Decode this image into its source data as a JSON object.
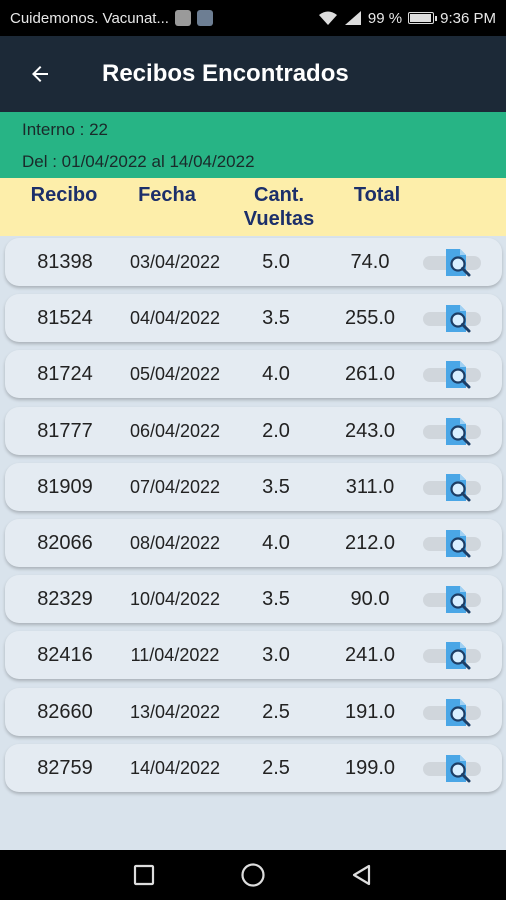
{
  "status_bar": {
    "notification_text": "Cuidemonos. Vacunat...",
    "battery_percent": "99 %",
    "time": "9:36 PM"
  },
  "app_bar": {
    "title": "Recibos Encontrados"
  },
  "info": {
    "interno": "Interno : 22",
    "rango": "Del : 01/04/2022 al 14/04/2022"
  },
  "table": {
    "headers": {
      "recibo": "Recibo",
      "fecha": "Fecha",
      "cant_line1": "Cant.",
      "cant_line2": "Vueltas",
      "total": "Total"
    },
    "rows": [
      {
        "recibo": "81398",
        "fecha": "03/04/2022",
        "cant": "5.0",
        "total": "74.0"
      },
      {
        "recibo": "81524",
        "fecha": "04/04/2022",
        "cant": "3.5",
        "total": "255.0"
      },
      {
        "recibo": "81724",
        "fecha": "05/04/2022",
        "cant": "4.0",
        "total": "261.0"
      },
      {
        "recibo": "81777",
        "fecha": "06/04/2022",
        "cant": "2.0",
        "total": "243.0"
      },
      {
        "recibo": "81909",
        "fecha": "07/04/2022",
        "cant": "3.5",
        "total": "311.0"
      },
      {
        "recibo": "82066",
        "fecha": "08/04/2022",
        "cant": "4.0",
        "total": "212.0"
      },
      {
        "recibo": "82329",
        "fecha": "10/04/2022",
        "cant": "3.5",
        "total": "90.0"
      },
      {
        "recibo": "82416",
        "fecha": "11/04/2022",
        "cant": "3.0",
        "total": "241.0"
      },
      {
        "recibo": "82660",
        "fecha": "13/04/2022",
        "cant": "2.5",
        "total": "191.0"
      },
      {
        "recibo": "82759",
        "fecha": "14/04/2022",
        "cant": "2.5",
        "total": "199.0"
      }
    ]
  },
  "icons": {
    "back": "arrow-back-icon",
    "row_action": "document-search-icon",
    "nav": [
      "square-recents-icon",
      "circle-home-icon",
      "triangle-back-icon"
    ]
  },
  "colors": {
    "app_bar": "#1c2937",
    "info_panel": "#27b485",
    "header_bg": "#fdeeaa",
    "header_text": "#1c2f6a",
    "row_bg": "#e4ebf2",
    "page_bg": "#d9e3ec",
    "icon_blue": "#4aa6e6"
  }
}
